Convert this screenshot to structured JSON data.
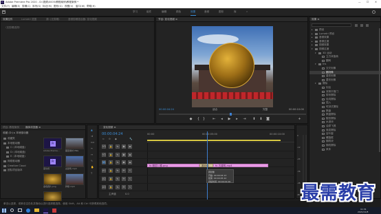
{
  "window": {
    "title": "Adobe Premiere Pro 2020 - D:\\视频\\0005\\教程案例\\教程案例 *",
    "controls": [
      "—",
      "☐",
      "✕"
    ]
  },
  "menu": [
    "文件(F)",
    "编辑(E)",
    "剪辑(C)",
    "序列(S)",
    "标记(M)",
    "图形(G)",
    "视图(V)",
    "窗口(W)",
    "帮助(H)"
  ],
  "workspaces": [
    "学习",
    "组件",
    "编辑",
    "颜色",
    "效果",
    "音频",
    "图形",
    "库"
  ],
  "workspace_active": "效果",
  "source_panel": {
    "tabs": [
      "效果控件",
      "Lumetri 范围",
      "源: (无剪辑)",
      "音频剪辑混合器: 变化视频"
    ],
    "subtitle": "（无剪辑选择）"
  },
  "program_monitor": {
    "title": "节目: 变化视频 ≡",
    "timecode": "00:00:04:24",
    "fit": "适合",
    "quality": "完整",
    "duration": "00:00:10:00"
  },
  "effects_panel": {
    "title": "效果 ≡",
    "items": [
      {
        "label": "预设",
        "level": 0,
        "kind": "folder"
      },
      {
        "label": "Lumetri 预设",
        "level": 0,
        "kind": "folder"
      },
      {
        "label": "音频效果",
        "level": 0,
        "kind": "folder"
      },
      {
        "label": "音频过渡",
        "level": 0,
        "kind": "folder"
      },
      {
        "label": "视频效果",
        "level": 0,
        "kind": "folder"
      },
      {
        "label": "视频过渡",
        "level": 0,
        "kind": "folder",
        "open": true
      },
      {
        "label": "3D 运动",
        "level": 1,
        "kind": "folder",
        "open": true
      },
      {
        "label": "立方体旋转",
        "level": 2,
        "kind": "effect"
      },
      {
        "label": "翻转",
        "level": 2,
        "kind": "effect"
      },
      {
        "label": "Iris",
        "level": 1,
        "kind": "folder",
        "open": true
      },
      {
        "label": "交叉划像",
        "level": 2,
        "kind": "effect"
      },
      {
        "label": "圆划像",
        "level": 2,
        "kind": "effect",
        "selected": true
      },
      {
        "label": "盒形划像",
        "level": 2,
        "kind": "effect"
      },
      {
        "label": "菱形划像",
        "level": 2,
        "kind": "effect"
      },
      {
        "label": "擦除",
        "level": 1,
        "kind": "folder",
        "open": true
      },
      {
        "label": "划出",
        "level": 2,
        "kind": "effect"
      },
      {
        "label": "双侧平推门",
        "level": 2,
        "kind": "effect"
      },
      {
        "label": "带状擦除",
        "level": 2,
        "kind": "effect"
      },
      {
        "label": "径向擦除",
        "level": 2,
        "kind": "effect"
      },
      {
        "label": "插入",
        "level": 2,
        "kind": "effect"
      },
      {
        "label": "时钟式擦除",
        "level": 2,
        "kind": "effect"
      },
      {
        "label": "棋盘",
        "level": 2,
        "kind": "effect"
      },
      {
        "label": "棋盘擦除",
        "level": 2,
        "kind": "effect"
      },
      {
        "label": "楔形擦除",
        "level": 2,
        "kind": "effect"
      },
      {
        "label": "水波块",
        "level": 2,
        "kind": "effect"
      },
      {
        "label": "油漆飞溅",
        "level": 2,
        "kind": "effect"
      },
      {
        "label": "渐变擦除",
        "level": 2,
        "kind": "effect"
      },
      {
        "label": "百叶窗",
        "level": 2,
        "kind": "effect"
      },
      {
        "label": "螺旋框",
        "level": 2,
        "kind": "effect"
      },
      {
        "label": "随机块",
        "level": 2,
        "kind": "effect"
      },
      {
        "label": "随机擦除",
        "level": 2,
        "kind": "effect"
      },
      {
        "label": "风车",
        "level": 2,
        "kind": "effect"
      }
    ]
  },
  "project_panel": {
    "tabs": [
      "项目: 教程案例",
      "媒体浏览器 ≡"
    ],
    "location": "收藏 (D:) ▸ 本地驱动器",
    "tree": [
      "收藏夹",
      "本地驱动器",
      "C: (本地磁盘)",
      "D: (本地磁盘)",
      "E: (本地磁盘)",
      "网络驱动器",
      "Creative Cloud",
      "团队项目版本"
    ],
    "thumbs": [
      {
        "label": "Adobe Premie...",
        "kind": "pr"
      },
      {
        "label": "图层素材 PNG",
        "kind": "img"
      },
      {
        "label": "变化视",
        "kind": "pr"
      },
      {
        "label": "古建筑.mp4",
        "kind": "img"
      },
      {
        "label": "金色圆片.png",
        "kind": "img"
      },
      {
        "label": "牌楼.mp4",
        "kind": "img"
      },
      {
        "label": "金色...",
        "kind": "img"
      }
    ]
  },
  "timeline": {
    "title": "变化视频 ≡",
    "timecode": "00:00:04:24",
    "ruler": [
      "00:00",
      "00:00:05:00",
      "00:00:10:00"
    ],
    "tracks": [
      {
        "name": "V3",
        "lock": "🔒"
      },
      {
        "name": "V2",
        "lock": "🔒"
      },
      {
        "name": "V1",
        "lock": "🔒"
      },
      {
        "name": "A1",
        "lock": "🔒"
      },
      {
        "name": "A2",
        "lock": "🔒"
      },
      {
        "name": "A3",
        "lock": "🔒"
      }
    ],
    "master": "主声道",
    "master_value": "0.0",
    "clips": [
      {
        "label": "fx 图层1 模.png"
      },
      {
        "label": "圆划像"
      },
      {
        "label": "fx 古建筑.mp4"
      }
    ],
    "tooltip": {
      "name": "圆划像",
      "start": "开始: 00:00:04:13",
      "end": "结束: 00:00:05:12",
      "duration": "持续时间: 00:00:01:00"
    }
  },
  "meter": {
    "scale": [
      "0",
      "-12",
      "-24",
      "-36",
      "-48",
      "dB"
    ]
  },
  "status": "单击以选择，或单击空白处并拖动以进行选择框选择。使用 Shift、Alt 和 Ctrl 可获得其他选项。",
  "taskbar": {
    "clock_time": "11:31",
    "clock_date": "2021/11/8"
  },
  "watermark": "最需教育",
  "colors": {
    "accent": "#3b8dd6",
    "clip_pink": "#e89be6",
    "transition": "#d4c3a0",
    "playhead": "#3d7fd0",
    "workarea": "#d7c842"
  }
}
